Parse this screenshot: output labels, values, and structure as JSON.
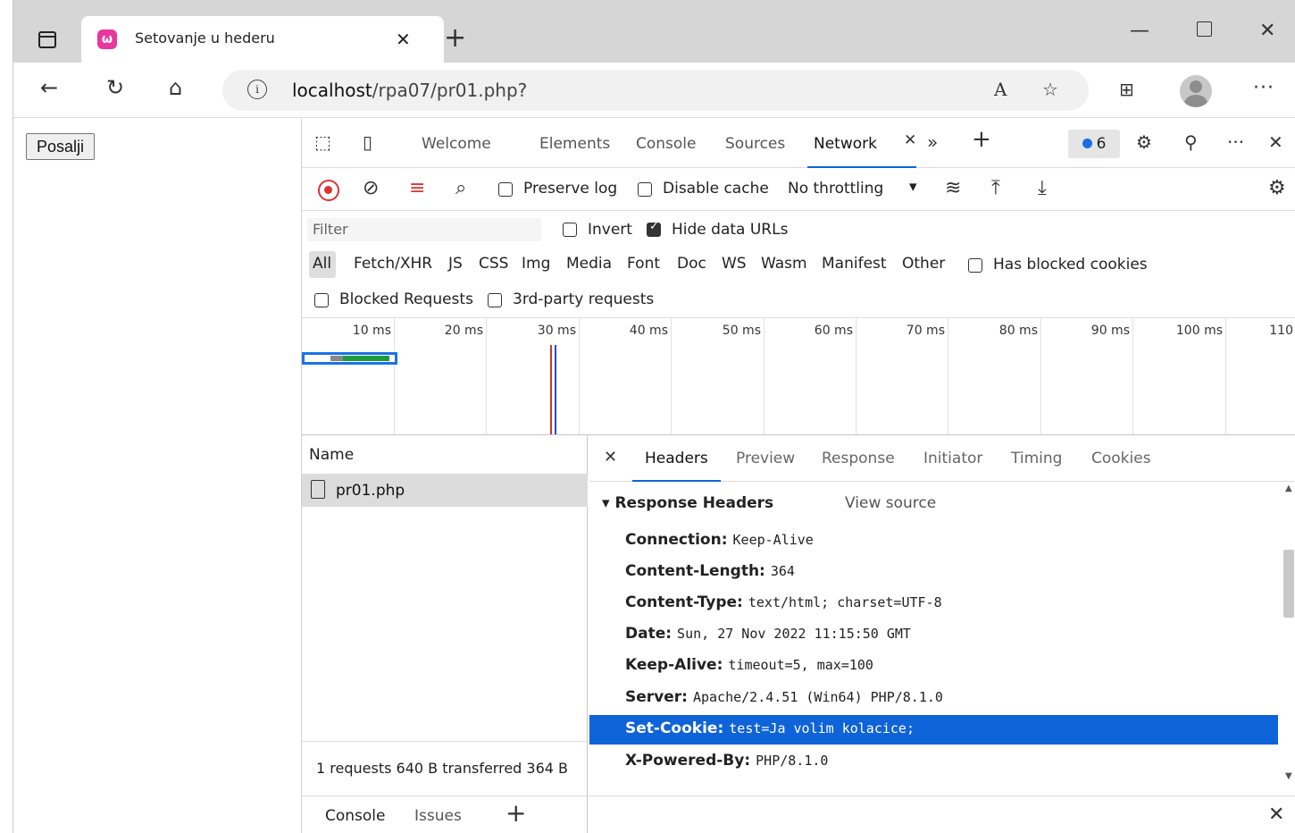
{
  "browser": {
    "tab_title": "Setovanje u hederu",
    "favicon_letter": "ω",
    "url_host": "localhost",
    "url_path": "/rpa07/pr01.php?"
  },
  "page": {
    "submit_label": "Posalji"
  },
  "devtools": {
    "tabs": [
      "Welcome",
      "Elements",
      "Console",
      "Sources",
      "Network"
    ],
    "active_tab": "Network",
    "issues_count": "6",
    "throttling": "No throttling",
    "preserve_log": "Preserve log",
    "disable_cache": "Disable cache",
    "filter_placeholder": "Filter",
    "invert": "Invert",
    "hide_data_urls": "Hide data URLs",
    "types": [
      "All",
      "Fetch/XHR",
      "JS",
      "CSS",
      "Img",
      "Media",
      "Font",
      "Doc",
      "WS",
      "Wasm",
      "Manifest",
      "Other"
    ],
    "has_blocked_cookies": "Has blocked cookies",
    "blocked_requests": "Blocked Requests",
    "third_party": "3rd-party requests",
    "timeline_ticks": [
      "10 ms",
      "20 ms",
      "30 ms",
      "40 ms",
      "50 ms",
      "60 ms",
      "70 ms",
      "80 ms",
      "90 ms",
      "100 ms",
      "110"
    ],
    "name_header": "Name",
    "request_name": "pr01.php",
    "status_summary": "1 requests  640 B transferred  364 B",
    "detail_tabs": [
      "Headers",
      "Preview",
      "Response",
      "Initiator",
      "Timing",
      "Cookies"
    ],
    "section_title": "Response Headers",
    "view_source": "View source",
    "headers": [
      {
        "key": "Connection:",
        "value": "Keep-Alive"
      },
      {
        "key": "Content-Length:",
        "value": "364"
      },
      {
        "key": "Content-Type:",
        "value": "text/html; charset=UTF-8"
      },
      {
        "key": "Date:",
        "value": "Sun, 27 Nov 2022 11:15:50 GMT"
      },
      {
        "key": "Keep-Alive:",
        "value": "timeout=5, max=100"
      },
      {
        "key": "Server:",
        "value": "Apache/2.4.51 (Win64) PHP/8.1.0"
      },
      {
        "key": "Set-Cookie:",
        "value": "test=Ja volim kolacice;"
      },
      {
        "key": "X-Powered-By:",
        "value": "PHP/8.1.0"
      }
    ],
    "drawer_tabs": [
      "Console",
      "Issues"
    ]
  },
  "colors": {
    "accent": "#0e63d8",
    "record": "#e0312f",
    "timing_green": "#1e9b3c"
  }
}
